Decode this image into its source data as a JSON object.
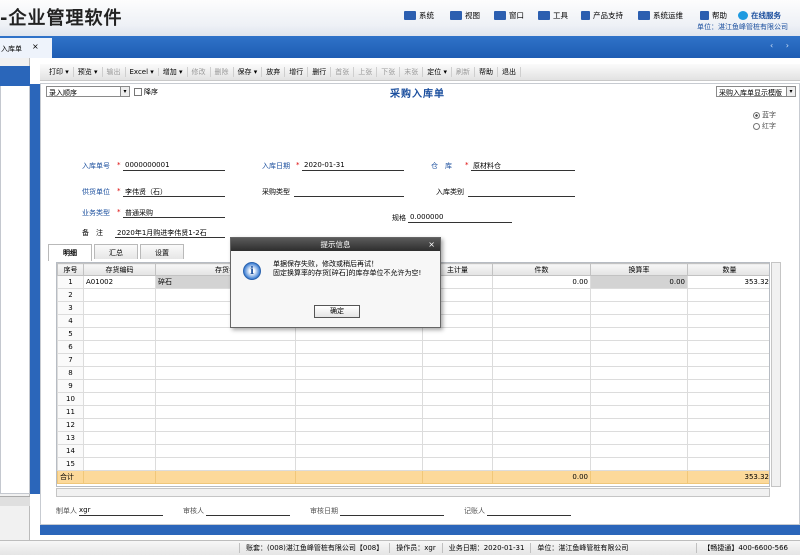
{
  "app": {
    "title": "-企业管理软件"
  },
  "topmenu": [
    {
      "label": "系统",
      "icon": "system-icon",
      "color": "#2c5fb0"
    },
    {
      "label": "视图",
      "icon": "view-icon",
      "color": "#2c5fb0"
    },
    {
      "label": "窗口",
      "icon": "window-icon",
      "color": "#2c5fb0"
    },
    {
      "label": "工具",
      "icon": "tools-icon",
      "color": "#2c5fb0"
    },
    {
      "label": "产品支持",
      "icon": "support-icon",
      "color": "#2c5fb0"
    },
    {
      "label": "系统运维",
      "icon": "maintenance-icon",
      "color": "#2c5fb0"
    },
    {
      "label": "帮助",
      "icon": "help-icon",
      "color": "#2c5fb0"
    },
    {
      "label": "在线服务",
      "icon": "online-service-icon",
      "color": "#1e9ae0"
    }
  ],
  "unit_info": "单位：湛江鱼峰管桩有限公司",
  "tab": {
    "label": "入库单",
    "close": "×",
    "nav": "‹ ›"
  },
  "toolbar": [
    {
      "label": "打印 ▾",
      "enabled": true
    },
    {
      "label": "预览 ▾",
      "enabled": true
    },
    {
      "label": "输出",
      "enabled": false
    },
    {
      "label": "Excel ▾",
      "enabled": true
    },
    {
      "label": "增加 ▾",
      "enabled": true
    },
    {
      "label": "修改",
      "enabled": false
    },
    {
      "label": "删除",
      "enabled": false
    },
    {
      "label": "保存 ▾",
      "enabled": true
    },
    {
      "label": "放弃",
      "enabled": true
    },
    {
      "label": "增行",
      "enabled": true
    },
    {
      "label": "删行",
      "enabled": true
    },
    {
      "label": "首张",
      "enabled": false
    },
    {
      "label": "上张",
      "enabled": false
    },
    {
      "label": "下张",
      "enabled": false
    },
    {
      "label": "末张",
      "enabled": false
    },
    {
      "label": "定位 ▾",
      "enabled": true
    },
    {
      "label": "刷新",
      "enabled": false
    },
    {
      "label": "帮助",
      "enabled": true
    },
    {
      "label": "退出",
      "enabled": true
    }
  ],
  "form": {
    "sort_select": "录入顺序",
    "desc_label": "降序",
    "title": "采购入库单",
    "template_select": "采购入库单显示模版",
    "radio_blue": "蓝字",
    "radio_red": "红字",
    "fields": {
      "doc_no_label": "入库单号",
      "doc_no": "0000000001",
      "date_label": "入库日期",
      "date": "2020-01-31",
      "warehouse_label": "仓　库",
      "warehouse": "原材料仓",
      "supplier_label": "供货单位",
      "supplier": "李伟贤（石）",
      "purchase_type_label": "采购类型",
      "purchase_type": "",
      "inbound_type_label": "入库类别",
      "inbound_type": "",
      "biz_type_label": "业务类型",
      "biz_type": "普通采购",
      "spec_label": "规格",
      "spec": "0.000000",
      "note_label": "备　注",
      "note": "2020年1月购进李伟贤1-2石"
    },
    "required_mark": "*"
  },
  "subtabs": [
    "明细",
    "汇总",
    "设置"
  ],
  "grid": {
    "columns": [
      "序号",
      "存货编码",
      "存货名",
      "",
      "主计量",
      "件数",
      "换算率",
      "数量"
    ],
    "rows": [
      {
        "no": "1",
        "code": "A01002",
        "name": "碎石",
        "count": "0.00",
        "rate": "0.00",
        "qty": "353.32"
      },
      {
        "no": "2"
      },
      {
        "no": "3"
      },
      {
        "no": "4"
      },
      {
        "no": "5"
      },
      {
        "no": "6"
      },
      {
        "no": "7"
      },
      {
        "no": "8"
      },
      {
        "no": "9"
      },
      {
        "no": "10"
      },
      {
        "no": "11"
      },
      {
        "no": "12"
      },
      {
        "no": "13"
      },
      {
        "no": "14"
      },
      {
        "no": "15"
      }
    ],
    "total": {
      "label": "合计",
      "count": "0.00",
      "qty": "353.32"
    }
  },
  "signatures": {
    "maker_label": "制单人",
    "maker": "xgr",
    "reviewer_label": "审核人",
    "reviewer": "",
    "review_date_label": "审核日期",
    "review_date": "",
    "bookkeeper_label": "记账人",
    "bookkeeper": ""
  },
  "status": {
    "account": "账套：(008)湛江鱼峰管桩有限公司【008】",
    "operator": "操作员：xgr",
    "biz_date": "业务日期：2020-01-31",
    "unit": "单位：湛江鱼峰管桩有限公司",
    "hotline": "【畅捷通】400-6600-566"
  },
  "dialog": {
    "title": "提示信息",
    "close": "×",
    "icon": "info-icon",
    "line1": "单据保存失败，修改或稍后再试！",
    "line2": "固定换算率的存货[碎石]的库存单位不允许为空!",
    "ok": "确定"
  }
}
